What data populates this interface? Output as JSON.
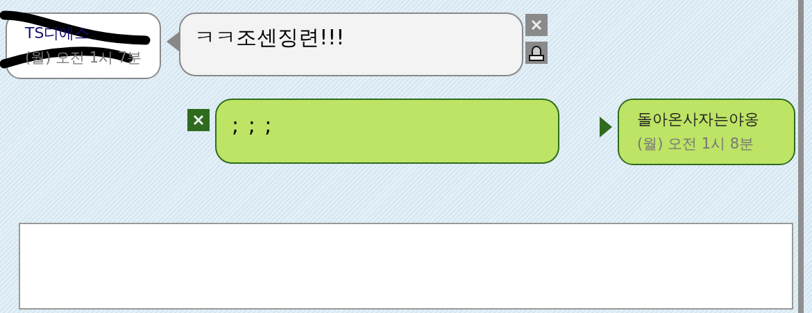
{
  "messages": [
    {
      "kind": "incoming",
      "sender": "TS디에스",
      "time": "(월) 오전 1시 7분",
      "text": "ㅋㅋ조센징련!!!",
      "redacted": true
    },
    {
      "kind": "outgoing",
      "sender": "돌아온사자는야옹",
      "time": "(월) 오전 1시 8분",
      "text": "; ; ;",
      "redacted": false
    }
  ]
}
